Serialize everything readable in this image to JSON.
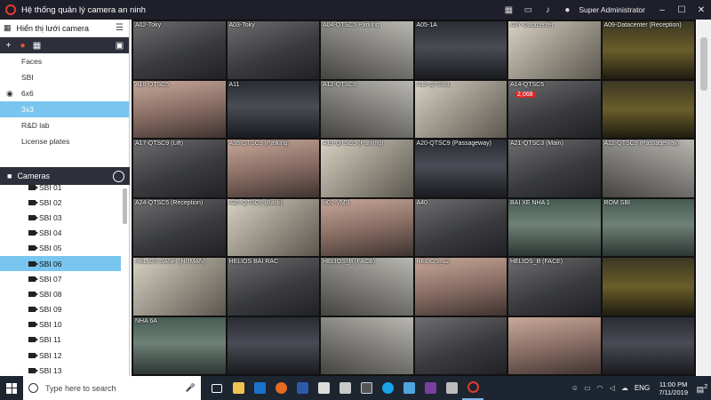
{
  "window": {
    "title": "Hệ thống quản lý camera an ninh",
    "user": "Super Administrator"
  },
  "sidebar": {
    "header": "Hiển thị lưới camera",
    "layouts": [
      {
        "label": "Faces"
      },
      {
        "label": "SBI"
      },
      {
        "label": "6x6",
        "visible": true
      },
      {
        "label": "3x3",
        "selected": true
      },
      {
        "label": "R&D lab"
      },
      {
        "label": "License plates"
      }
    ],
    "cameras_header": "Cameras",
    "cameras": [
      "SBI 01",
      "SBI 02",
      "SBI 03",
      "SBI 04",
      "SBI 05",
      "SBI 06",
      "SBI 07",
      "SBI 08",
      "SBI 09",
      "SBI 10",
      "SBI 11",
      "SBI 12",
      "SBI 13"
    ],
    "selected_camera": "SBI 06"
  },
  "grid": {
    "tiles": [
      {
        "label": "A02-Toky"
      },
      {
        "label": "A03-Toky"
      },
      {
        "label": "A04-QTSC5 Parking"
      },
      {
        "label": "A05-1A"
      },
      {
        "label": "A07-Datacenter"
      },
      {
        "label": "A09-Datacenter (Reception)"
      },
      {
        "label": "A10-QTSC5"
      },
      {
        "label": "A11"
      },
      {
        "label": "A12-QTSC5"
      },
      {
        "label": "A13-QTSC1"
      },
      {
        "label": "A14-QTSC5",
        "badge": "2,068"
      },
      {
        "label": ""
      },
      {
        "label": "A17-QTSC9 (Lift)"
      },
      {
        "label": "A18-QTSC9 (Parking)"
      },
      {
        "label": "A19-QTSC9 (Parking)"
      },
      {
        "label": "A20-QTSC9 (Passageway)"
      },
      {
        "label": "A21-QTSC3 (Main)"
      },
      {
        "label": "A22-QTSC9 (Passageway)"
      },
      {
        "label": "A24-QTSC5 (Reception)"
      },
      {
        "label": "A25-QTSC5 (Back)"
      },
      {
        "label": "H01-VMS"
      },
      {
        "label": "A40"
      },
      {
        "label": "BAI XE NHA 1"
      },
      {
        "label": "ROM SBI"
      },
      {
        "label": "HELIOS SANH (HUMAN)"
      },
      {
        "label": "HELIOS BAI RAC"
      },
      {
        "label": "HELIOS_B (FACE)"
      },
      {
        "label": "HELIOS_L2"
      },
      {
        "label": "HELIOS_B (FACE)"
      },
      {
        "label": ""
      },
      {
        "label": "NHA 6A"
      },
      {
        "label": ""
      },
      {
        "label": ""
      },
      {
        "label": ""
      },
      {
        "label": ""
      },
      {
        "label": ""
      }
    ]
  },
  "taskbar": {
    "search_placeholder": "Type here to search",
    "language": "ENG",
    "time": "11:00 PM",
    "date": "7/11/2019",
    "notifications": "2"
  },
  "colors": {
    "accent": "#78c6ef",
    "titlebar": "#1e1f2a",
    "alert": "#d62828"
  }
}
